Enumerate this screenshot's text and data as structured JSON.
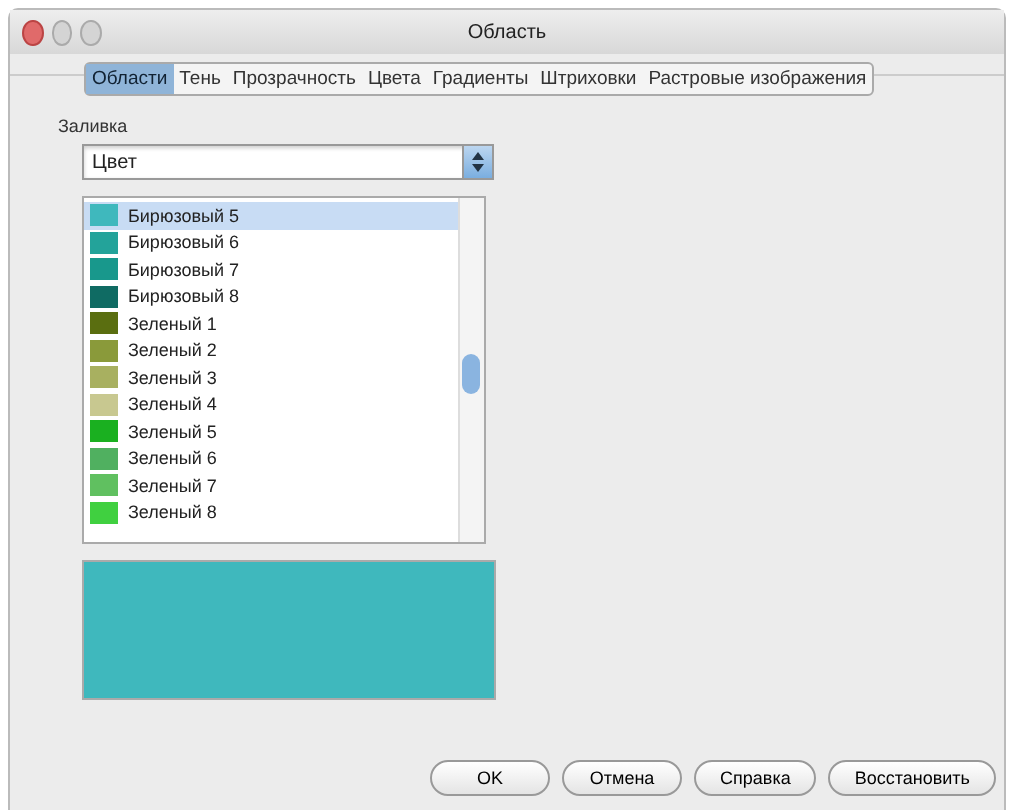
{
  "window": {
    "title": "Область"
  },
  "tabs": [
    {
      "label": "Области",
      "selected": true
    },
    {
      "label": "Тень",
      "selected": false
    },
    {
      "label": "Прозрачность",
      "selected": false
    },
    {
      "label": "Цвета",
      "selected": false
    },
    {
      "label": "Градиенты",
      "selected": false
    },
    {
      "label": "Штриховки",
      "selected": false
    },
    {
      "label": "Растровые изображения",
      "selected": false
    }
  ],
  "fill": {
    "label": "Заливка",
    "type": {
      "value": "Цвет"
    },
    "colors": [
      {
        "name": "Бирюзовый 5",
        "color": "#3fb8bd",
        "selected": true
      },
      {
        "name": "Бирюзовый 6",
        "color": "#23a39a",
        "selected": false
      },
      {
        "name": "Бирюзовый 7",
        "color": "#18988c",
        "selected": false
      },
      {
        "name": "Бирюзовый 8",
        "color": "#0f6b63",
        "selected": false
      },
      {
        "name": "Зеленый 1",
        "color": "#5a6e10",
        "selected": false
      },
      {
        "name": "Зеленый 2",
        "color": "#8a9a3a",
        "selected": false
      },
      {
        "name": "Зеленый 3",
        "color": "#a8b060",
        "selected": false
      },
      {
        "name": "Зеленый 4",
        "color": "#c8c890",
        "selected": false
      },
      {
        "name": "Зеленый 5",
        "color": "#1ab020",
        "selected": false
      },
      {
        "name": "Зеленый 6",
        "color": "#50b060",
        "selected": false
      },
      {
        "name": "Зеленый 7",
        "color": "#60c060",
        "selected": false
      },
      {
        "name": "Зеленый 8",
        "color": "#40d040",
        "selected": false
      }
    ]
  },
  "buttons": [
    "OK",
    "Отмена",
    "Справка",
    "Восстановить"
  ]
}
